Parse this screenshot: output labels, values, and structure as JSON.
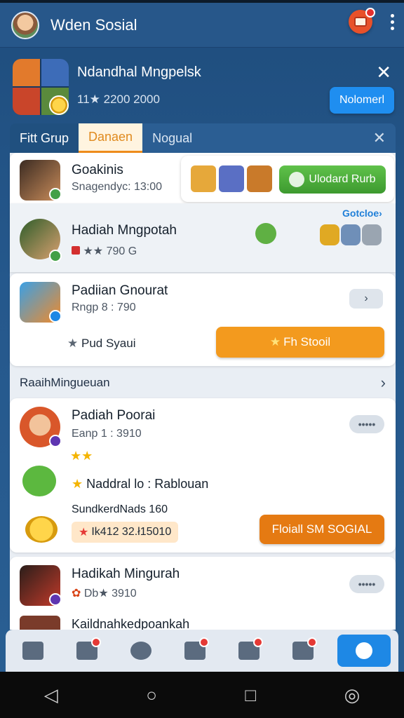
{
  "appbar": {
    "title": "Wden Sosial"
  },
  "banner": {
    "title": "Ndandhal Mngpelsk",
    "subtitle": "11★ 2200 2000",
    "button_label": "Nolomerl"
  },
  "tabs": [
    {
      "label": "Fitt Grup",
      "active": false
    },
    {
      "label": "Danaen",
      "active": true
    },
    {
      "label": "Nogual",
      "active": false
    }
  ],
  "feed": {
    "row1": {
      "name": "Goakinis",
      "meta": "Snagendyc: 13:00",
      "promo_button": "Ulodard Rurb"
    },
    "row2": {
      "name": "Hadiah Mngpotah",
      "meta": "★★ 790 G",
      "link": "Gotcloe›"
    },
    "row3": {
      "name": "Padiian Gnourat",
      "meta": "Rngp  8 : 790",
      "secondary_label": "Pud Syaui",
      "action_button": "Fh Stooil"
    },
    "section": {
      "title": "RaaihMingueuan"
    },
    "row4": {
      "name": "Padiah Poorai",
      "meta": "Eanp  1 : 3910",
      "stars": "★★",
      "line": "Naddral lo  : Rablouan",
      "sub_line": "SundkerdNads 160",
      "tag": "Ik412 32.ł15010",
      "action_button": "Floiall SM SOGIAL",
      "more": "•••••"
    },
    "row5": {
      "name": "Hadikah Mingurah",
      "meta": "Db★ 3910",
      "more": "•••••"
    },
    "row6": {
      "name": "Kaildnahkedpoankah"
    }
  },
  "colors": {
    "brand_blue": "#27578a",
    "accent_orange": "#f39a1e",
    "accent_green": "#4caf3a",
    "primary_button": "#1f8ef0"
  },
  "bottom_nav": [
    {
      "icon": "home-icon"
    },
    {
      "icon": "thumb-icon"
    },
    {
      "icon": "chat-icon"
    },
    {
      "icon": "share-icon"
    },
    {
      "icon": "task-icon"
    },
    {
      "icon": "rocket-icon"
    },
    {
      "icon": "gear-icon"
    }
  ]
}
